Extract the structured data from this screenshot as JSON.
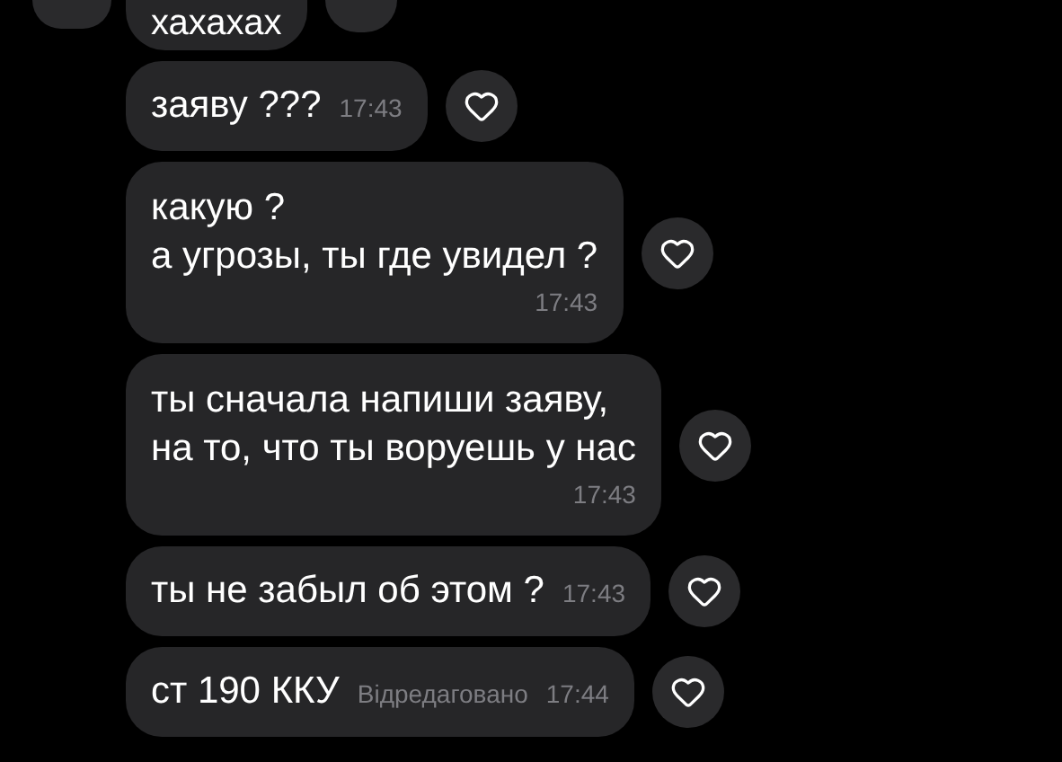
{
  "messages": [
    {
      "kind": "cut",
      "lines": [
        "хахахах"
      ]
    },
    {
      "kind": "inline",
      "lines": [
        "заяву ???"
      ],
      "time": "17:43"
    },
    {
      "kind": "block",
      "lines": [
        "какую ?",
        "а угрозы, ты где увидел ?"
      ],
      "time": "17:43"
    },
    {
      "kind": "block",
      "lines": [
        "ты сначала напиши заяву,",
        "на то, что ты воруешь у нас"
      ],
      "time": "17:43"
    },
    {
      "kind": "inline",
      "lines": [
        "ты не забыл об этом ?"
      ],
      "time": "17:43"
    },
    {
      "kind": "inline",
      "lines": [
        "ст 190 ККУ"
      ],
      "edited": "Відредаговано",
      "time": "17:44"
    }
  ]
}
